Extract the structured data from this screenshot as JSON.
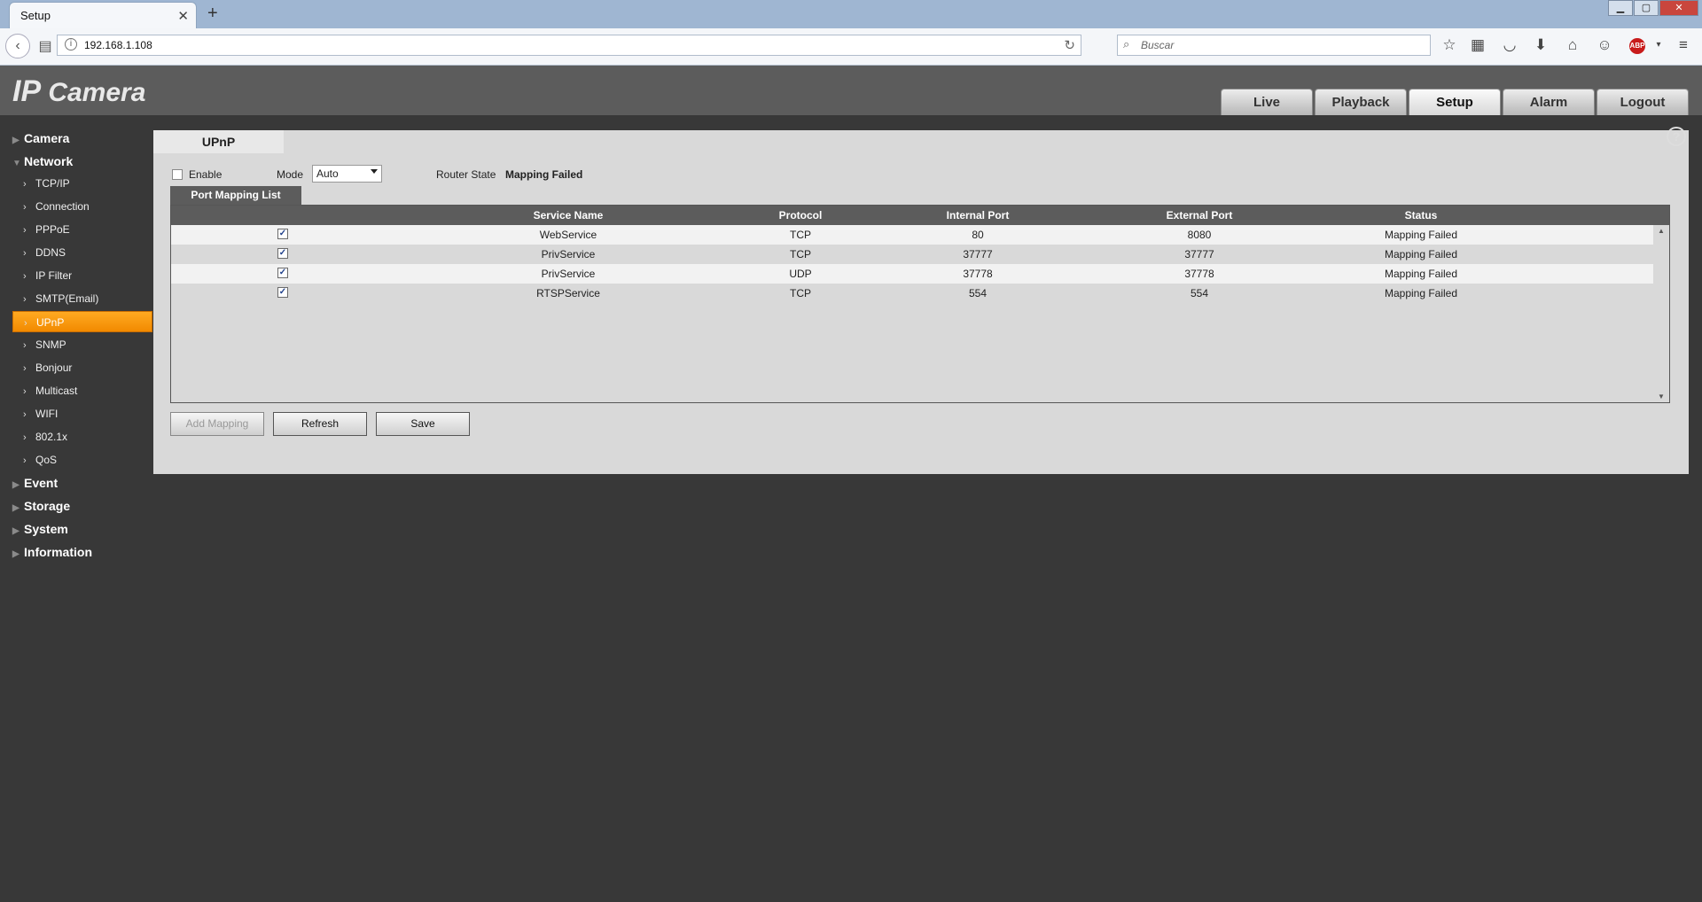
{
  "browser": {
    "tab_title": "Setup",
    "url": "192.168.1.108",
    "search_placeholder": "Buscar",
    "icons": [
      "back-icon",
      "identity-icon",
      "info-icon",
      "reload-icon",
      "search-icon",
      "bookmark-star-icon",
      "reading-list-icon",
      "pocket-icon",
      "download-icon",
      "home-icon",
      "chat-icon",
      "adblock-icon",
      "menu-icon"
    ],
    "adblock_label": "ABP"
  },
  "app": {
    "logo_ip": "IP",
    "logo_camera": "Camera",
    "nav": [
      "Live",
      "Playback",
      "Setup",
      "Alarm",
      "Logout"
    ],
    "active_nav": "Setup",
    "help_label": "?"
  },
  "sidebar": {
    "sections_top": [
      {
        "label": "Camera",
        "expanded": false
      },
      {
        "label": "Network",
        "expanded": true
      }
    ],
    "network_items": [
      "TCP/IP",
      "Connection",
      "PPPoE",
      "DDNS",
      "IP Filter",
      "SMTP(Email)",
      "UPnP",
      "SNMP",
      "Bonjour",
      "Multicast",
      "WIFI",
      "802.1x",
      "QoS"
    ],
    "active_item": "UPnP",
    "sections_bottom": [
      "Event",
      "Storage",
      "System",
      "Information"
    ]
  },
  "upnp": {
    "page_tab": "UPnP",
    "enable_label": "Enable",
    "enable_checked": false,
    "mode_label": "Mode",
    "mode_value": "Auto",
    "router_state_label": "Router State",
    "router_state_value": "Mapping Failed",
    "list_tab": "Port Mapping List",
    "columns": [
      "Service Name",
      "Protocol",
      "Internal Port",
      "External Port",
      "Status"
    ],
    "rows": [
      {
        "checked": true,
        "service": "WebService",
        "protocol": "TCP",
        "internal": "80",
        "external": "8080",
        "status": "Mapping Failed"
      },
      {
        "checked": true,
        "service": "PrivService",
        "protocol": "TCP",
        "internal": "37777",
        "external": "37777",
        "status": "Mapping Failed"
      },
      {
        "checked": true,
        "service": "PrivService",
        "protocol": "UDP",
        "internal": "37778",
        "external": "37778",
        "status": "Mapping Failed"
      },
      {
        "checked": true,
        "service": "RTSPService",
        "protocol": "TCP",
        "internal": "554",
        "external": "554",
        "status": "Mapping Failed"
      }
    ],
    "buttons": {
      "add": "Add Mapping",
      "refresh": "Refresh",
      "save": "Save"
    }
  }
}
